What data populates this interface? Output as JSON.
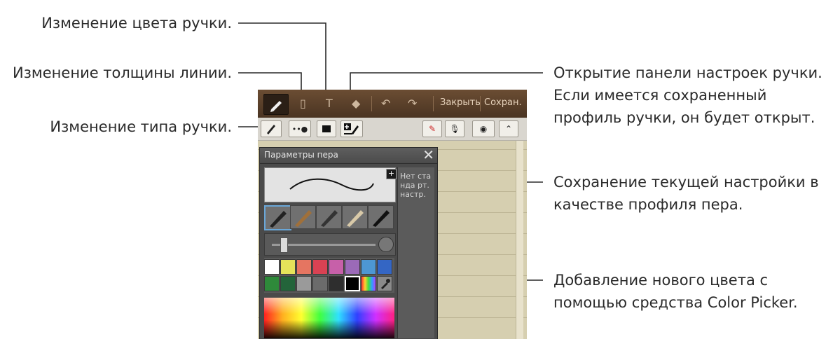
{
  "annotations": {
    "pen_color": "Изменение цвета ручки.",
    "line_width": "Изменение толщины линии.",
    "pen_type": "Изменение типа ручки.",
    "pen_settings": [
      "Открытие панели настроек ручки.",
      "Если имеется сохраненный",
      "профиль ручки, он будет открыт."
    ],
    "save_profile": [
      "Сохранение текущей настройки в",
      "качестве профиля пера."
    ],
    "add_color": [
      "Добавление нового цвета с",
      "помощью средства Color Picker."
    ]
  },
  "app": {
    "close_label": "Закрыть",
    "save_label": "Сохран.",
    "panel": {
      "title": "Параметры пера",
      "profile_empty": "Нет станда рт. настр."
    },
    "palette_row1": [
      "#ffffff",
      "#e5e35a",
      "#e57561",
      "#d94253",
      "#c760a9",
      "#9b6ab8",
      "#4d97d3",
      "#3466c4"
    ],
    "palette_row2": [
      "#2e8a3a",
      "#23643a",
      "#9a9a9a",
      "#6b6b6b",
      "#2e2e2e",
      "#000000"
    ]
  }
}
